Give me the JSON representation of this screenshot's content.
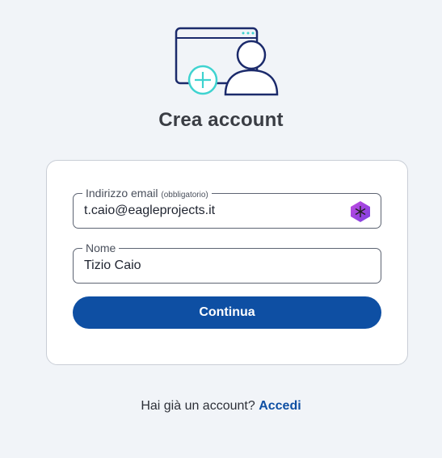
{
  "header": {
    "title": "Crea account",
    "illustration": "create-account-icon"
  },
  "form": {
    "email": {
      "label": "Indirizzo email",
      "required_note": "(obbligatorio)",
      "value": "t.caio@eagleprojects.it",
      "extension_icon": "password-manager-icon"
    },
    "name": {
      "label": "Nome",
      "value": "Tizio Caio"
    },
    "submit_label": "Continua"
  },
  "footer": {
    "prompt": "Hai già un account?",
    "login_link": "Accedi"
  },
  "colors": {
    "primary": "#0e4fa3",
    "background": "#f1f4f8",
    "illustration_stroke": "#1b2a6b",
    "illustration_accent": "#3fd3d0"
  }
}
